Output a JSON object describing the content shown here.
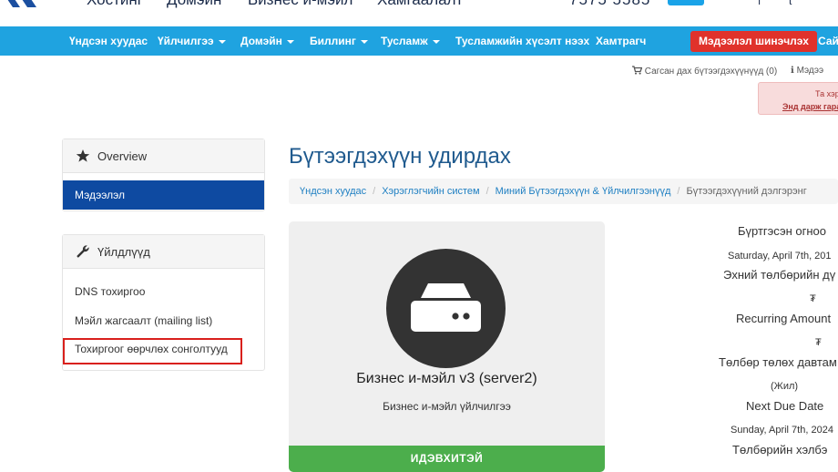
{
  "header": {
    "links": [
      "Хостинг",
      "Домэйн",
      "Бизнес и-мэйл",
      "Хамгаалалт"
    ],
    "phone": "7575 5585"
  },
  "navbar": {
    "items": [
      {
        "label": "Үндсэн хуудас",
        "dropdown": false
      },
      {
        "label": "Үйлчилгээ",
        "dropdown": true
      },
      {
        "label": "Домэйн",
        "dropdown": true
      },
      {
        "label": "Биллинг",
        "dropdown": true
      },
      {
        "label": "Тусламж",
        "dropdown": true
      },
      {
        "label": "Тусламжийн хүсэлт нээх",
        "dropdown": false
      },
      {
        "label": "Хамтрагч",
        "dropdown": false
      }
    ],
    "update_button": "Мэдээлэл шинэчлэх",
    "last_item": "Сай"
  },
  "cart": {
    "cart_label": "Сагсан дах бүтээгдэхүүнүүд (0)",
    "info_label": "Мэдээ"
  },
  "alert": {
    "line1": "Та хэр",
    "line2": "Энд дарж гара"
  },
  "sidebar": {
    "overview_title": "Overview",
    "active_item": "Мэдээлэл",
    "actions_title": "Үйлдлүүд",
    "actions": [
      "DNS тохиргоо",
      "Мэйл жагсаалт (mailing list)",
      "Тохиргоог өөрчлөх сонголтууд"
    ]
  },
  "main": {
    "title": "Бүтээгдэхүүн удирдах",
    "breadcrumb": [
      "Үндсэн хуудас",
      "Хэрэглэгчийн систем",
      "Миний Бүтээгдэхүүн & Үйлчилгээнүүд",
      "Бүтээгдэхүүний дэлгэрэнг"
    ]
  },
  "product": {
    "name": "Бизнес и-мэйл v3 (server2)",
    "group": "Бизнес и-мэйл үйлчилгээ",
    "status": "ИДЭВХИТЭЙ",
    "icon": "server-icon"
  },
  "details": {
    "registration_label": "Бүртгэсэн огноо",
    "registration_date": "Saturday, April 7th, 201",
    "first_payment_label": "Эхний төлбөрийн дү",
    "first_payment_value": "₮",
    "recurring_label": "Recurring Amount",
    "recurring_value": "₮",
    "billing_cycle_label": "Төлбөр төлөх давтам",
    "billing_cycle_value": "(Жил)",
    "next_due_label": "Next Due Date",
    "next_due_value": "Sunday, April 7th, 2024",
    "payment_method_label": "Төлбөрийн хэлбэ"
  },
  "colors": {
    "navbar": "#1fa3e0",
    "active_sidebar": "#0e4aa1",
    "update_button": "#e0322b",
    "status_active": "#4cae4c",
    "title": "#1f5a8e",
    "highlight": "#d9201c"
  }
}
